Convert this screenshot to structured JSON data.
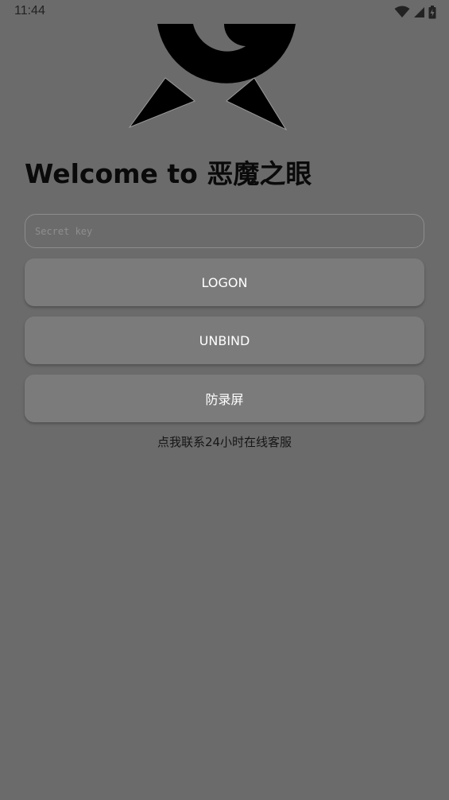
{
  "status_bar": {
    "time": "11:44",
    "icons": [
      "wifi-icon",
      "cell-signal-icon",
      "battery-icon"
    ]
  },
  "login": {
    "title": "Welcome to 恶魔之眼",
    "secret_placeholder": "Secret key",
    "secret_value": ""
  },
  "buttons": {
    "logon": "LOGON",
    "unbind": "UNBIND",
    "anti_record": "防录屏"
  },
  "support": {
    "link_text": "点我联系24小时在线客服"
  },
  "colors": {
    "background": "#6b6b6b",
    "button": "#7b7b7b",
    "button_text": "#ffffff",
    "logo": "#000000"
  }
}
